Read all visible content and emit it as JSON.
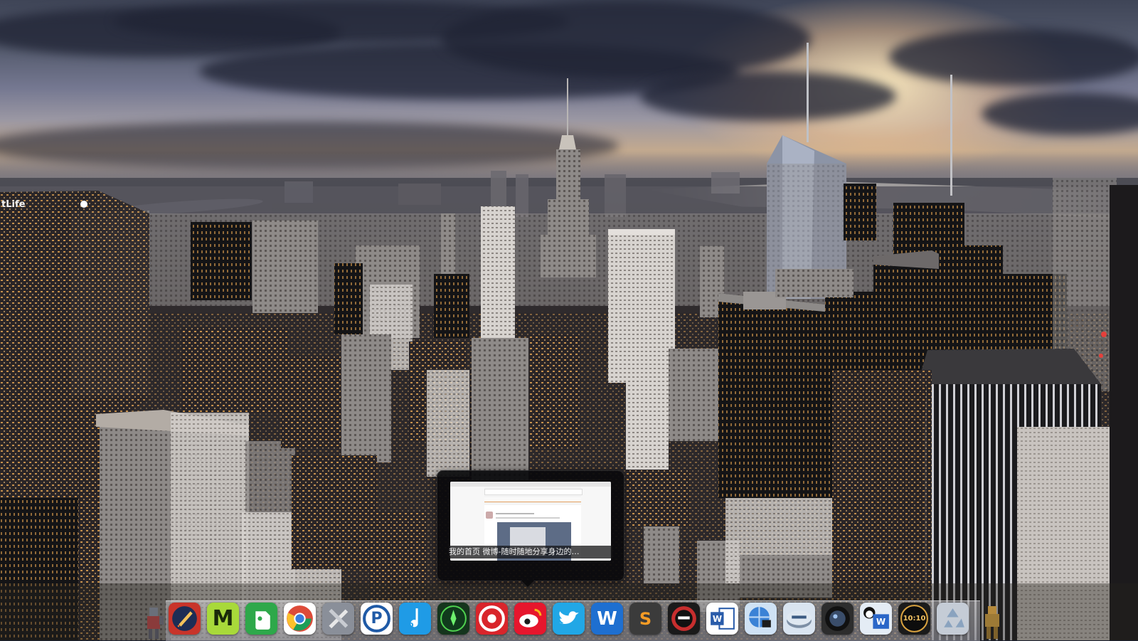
{
  "screen": {
    "width": 1600,
    "height": 900
  },
  "wallpaper": {
    "name": "new-york-skyline-wallpaper",
    "billboard_text": "tLife",
    "colors": {
      "sky_dark": "#3f4557",
      "sun_glow": "#ffecbe",
      "city": "#3e3a3c"
    }
  },
  "preview": {
    "title": "我的首页 微博-随时随地分享身边的…",
    "thumbnail_text": "weibo",
    "colors": {
      "background": "#0a0a0c",
      "text": "#f2f2f2"
    }
  },
  "dock": {
    "apps": [
      {
        "id": "rocket",
        "icon": "rocket-icon",
        "glyph": "",
        "bg": "#c8342a"
      },
      {
        "id": "mindmap",
        "icon": "m-app-icon",
        "glyph": "M",
        "bg": "#a8d93a"
      },
      {
        "id": "evernote",
        "icon": "evernote-icon",
        "glyph": "",
        "bg": "#2ea84a"
      },
      {
        "id": "chrome",
        "icon": "chrome-icon",
        "glyph": "",
        "bg": "#ffffff"
      },
      {
        "id": "utilities",
        "icon": "tools-icon",
        "glyph": "",
        "bg": "#8a8f99"
      },
      {
        "id": "p-app-1",
        "icon": "p-circle-icon",
        "glyph": "P",
        "bg": "#ffffff"
      },
      {
        "id": "music-d",
        "icon": "music-note-icon",
        "glyph": "D",
        "bg": "#1f9be6"
      },
      {
        "id": "game-green",
        "icon": "green-emblem-icon",
        "glyph": "",
        "bg": "#15351d"
      },
      {
        "id": "netease-music",
        "icon": "netease-music-icon",
        "glyph": "",
        "bg": "#d9252b"
      },
      {
        "id": "weibo",
        "icon": "weibo-icon",
        "glyph": "",
        "bg": "#e6162d"
      },
      {
        "id": "twitter",
        "icon": "twitter-icon",
        "glyph": "",
        "bg": "#21a7e6"
      },
      {
        "id": "word-w",
        "icon": "w-app-icon",
        "glyph": "W",
        "bg": "#1e6fd0"
      },
      {
        "id": "sublime",
        "icon": "sublime-icon",
        "glyph": "S",
        "bg": "#3b3b3b"
      },
      {
        "id": "ninja",
        "icon": "ninja-icon",
        "glyph": "",
        "bg": "#1a1a1a"
      },
      {
        "id": "ms-word",
        "icon": "word-doc-icon",
        "glyph": "W",
        "bg": "#ffffff"
      },
      {
        "id": "globe-lock",
        "icon": "globe-lock-icon",
        "glyph": "",
        "bg": "#cfe2f5"
      },
      {
        "id": "disk-util",
        "icon": "disk-icon",
        "glyph": "",
        "bg": "#d9e4f0"
      },
      {
        "id": "camera",
        "icon": "camera-lens-icon",
        "glyph": "",
        "bg": "#2d2d2d"
      },
      {
        "id": "qq-word",
        "icon": "qq-word-icon",
        "glyph": "W",
        "bg": "#e4ecf5"
      },
      {
        "id": "clock",
        "icon": "clock-icon",
        "glyph": "10:10",
        "bg": "#1b1b1b"
      },
      {
        "id": "recycle",
        "icon": "recycle-icon",
        "glyph": "",
        "bg": "#c5ccd6"
      }
    ]
  }
}
